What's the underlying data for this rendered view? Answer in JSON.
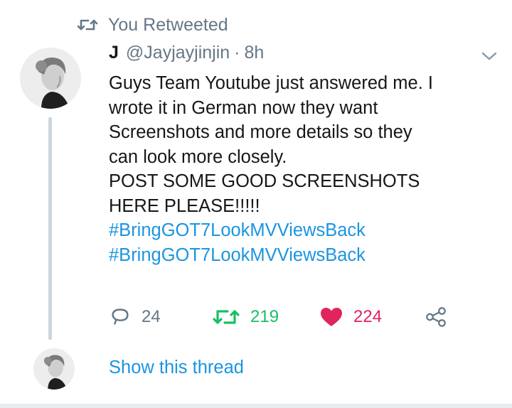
{
  "social_context": {
    "icon": "retweet-icon",
    "text": "You Retweeted"
  },
  "tweet": {
    "author_name": "J",
    "author_handle": "@Jayjayjinjin",
    "separator": "·",
    "time": "8h",
    "text_lines": [
      "Guys Team Youtube just answered me. I",
      "wrote it in German now they want",
      "Screenshots and more details so they",
      "can look more closely.",
      "POST SOME GOOD SCREENSHOTS",
      "HERE PLEASE!!!!!"
    ],
    "hashtags": [
      "#BringGOT7LookMVViewsBack",
      "#BringGOT7LookMVViewsBack"
    ],
    "actions": {
      "reply_count": "24",
      "retweet_count": "219",
      "like_count": "224"
    },
    "colors": {
      "retweet_active": "#17bf63",
      "like_active": "#e0245e",
      "link": "#1b95e0",
      "muted": "#657786"
    }
  },
  "thread": {
    "show_thread_label": "Show this thread"
  }
}
